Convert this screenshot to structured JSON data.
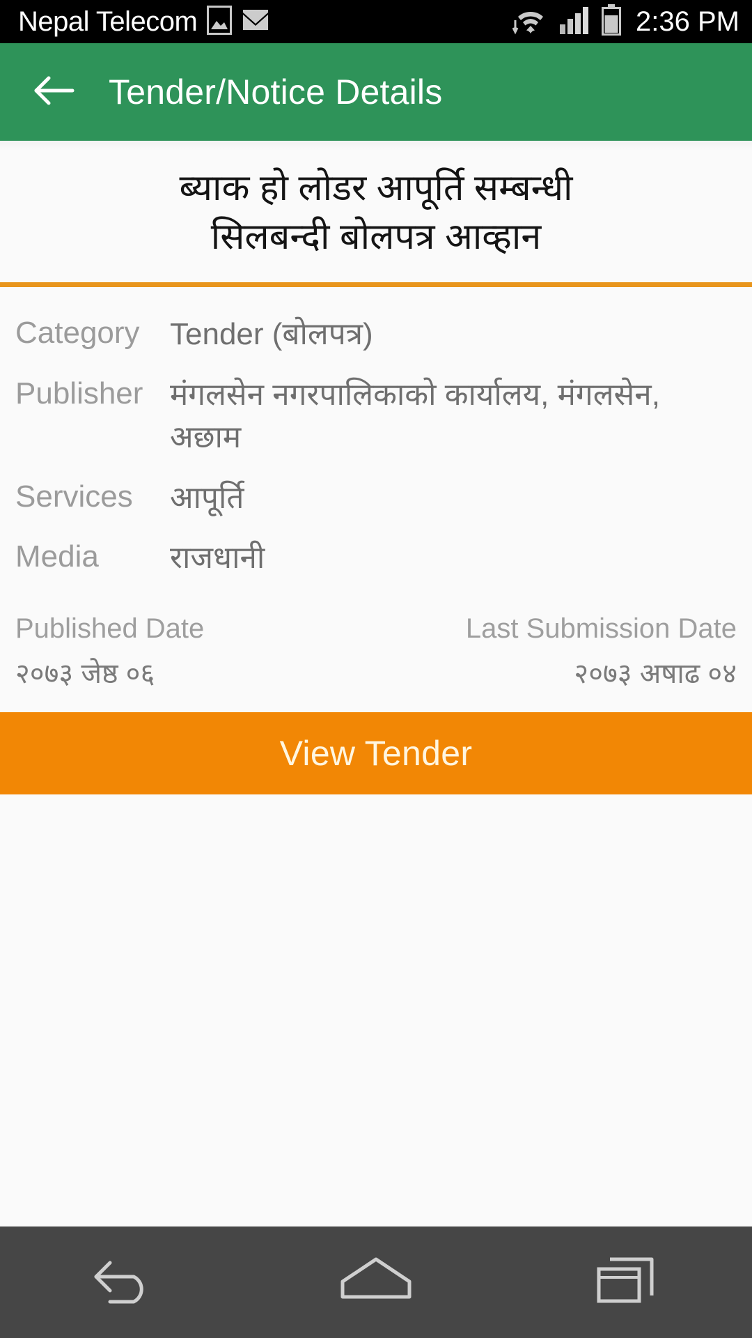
{
  "status_bar": {
    "carrier": "Nepal Telecom",
    "clock": "2:36 PM",
    "icons": [
      "screenshot-image-icon",
      "email-envelope-icon",
      "wifi-icon",
      "cellular-signal-icon",
      "battery-icon"
    ]
  },
  "app_bar": {
    "back_label": "back-arrow",
    "title": "Tender/Notice Details",
    "background_color": "#2e9359"
  },
  "notice": {
    "title_line_1": "ब्याक हो लोडर आपूर्ति सम्बन्धी",
    "title_line_2": "सिलबन्दी बोलपत्र आव्हान",
    "accent_color": "#e8951c"
  },
  "details": {
    "rows": [
      {
        "label": "Category",
        "value": "Tender (बोलपत्र)"
      },
      {
        "label": "Publisher",
        "value": "मंगलसेन नगरपालिकाको कार्यालय, मंगलसेन, अछाम"
      },
      {
        "label": "Services",
        "value": "आपूर्ति"
      },
      {
        "label": "Media",
        "value": "राजधानी"
      }
    ]
  },
  "dates": {
    "published_label": "Published Date",
    "published_value": "२०७३ जेष्ठ ०६",
    "submission_label": "Last Submission Date",
    "submission_value": "२०७३ अषाढ ०४"
  },
  "cta": {
    "label": "View Tender",
    "background_color": "#f28705",
    "text_color": "#fff6e0"
  },
  "nav_bar": {
    "back": "nav-back-icon",
    "home": "nav-home-icon",
    "recents": "nav-recents-icon",
    "background_color": "#464646"
  }
}
